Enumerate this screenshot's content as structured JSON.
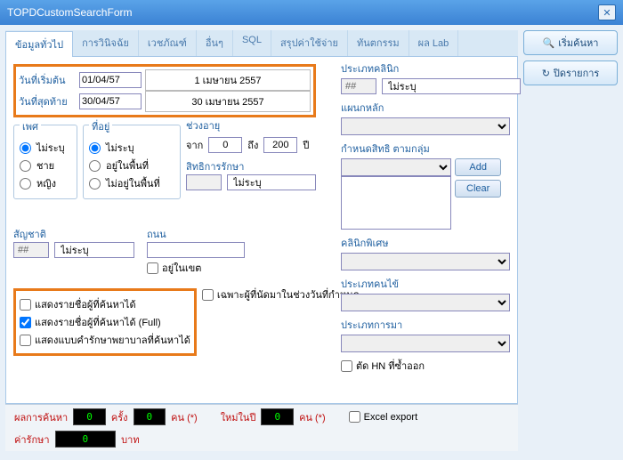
{
  "window": {
    "title": "TOPDCustomSearchForm"
  },
  "actions": {
    "search": "เริ่มค้นหา",
    "close": "ปิดรายการ"
  },
  "tabs": [
    "ข้อมูลทั่วไป",
    "การวินิจฉัย",
    "เวชภัณฑ์",
    "อื่นๆ",
    "SQL",
    "สรุปค่าใช้จ่าย",
    "ทันตกรรม",
    "ผล Lab"
  ],
  "dates": {
    "start_lbl": "วันที่เริ่มต้น",
    "start_val": "01/04/57",
    "start_txt": "1 เมษายน 2557",
    "end_lbl": "วันที่สุดท้าย",
    "end_val": "30/04/57",
    "end_txt": "30 เมษายน 2557"
  },
  "gender": {
    "title": "เพศ",
    "opts": [
      "ไม่ระบุ",
      "ชาย",
      "หญิง"
    ]
  },
  "location": {
    "title": "ที่อยู่",
    "opts": [
      "ไม่ระบุ",
      "อยู่ในพื้นที่",
      "ไม่อยู่ในพื้นที่"
    ]
  },
  "age": {
    "title": "ช่วงอายุ",
    "from_lbl": "จาก",
    "from": "0",
    "to_lbl": "ถึง",
    "to": "200",
    "unit": "ปี"
  },
  "insurance": {
    "lbl": "สิทธิการรักษา",
    "code": "",
    "txt": "ไม่ระบุ"
  },
  "clinic_type": {
    "lbl": "ประเภทคลินิก",
    "code": "##",
    "txt": "ไม่ระบุ"
  },
  "main_dept": {
    "lbl": "แผนกหลัก"
  },
  "rights_group": {
    "lbl": "กำหนดสิทธิ ตามกลุ่ม",
    "add": "Add",
    "clear": "Clear"
  },
  "special_clinic": {
    "lbl": "คลินิกพิเศษ"
  },
  "nationality": {
    "lbl": "สัญชาติ",
    "code": "##",
    "txt": "ไม่ระบุ"
  },
  "road": {
    "lbl": "ถนน",
    "in_area": "อยู่ในเขต"
  },
  "user_type": {
    "lbl": "ประเภทคนไข้"
  },
  "visit_type": {
    "lbl": "ประเภทการมา"
  },
  "checks": {
    "c1": "แสดงรายชื่อผู้ที่ค้นหาได้",
    "c2": "แสดงรายชื่อผู้ที่ค้นหาได้ (Full)",
    "c3": "แสดงแบบคำรักษาพยาบาลที่ค้นหาได้",
    "c4": "เฉพาะผู้ที่นัดมาในช่วงวันที่กำหนด",
    "c5": "ตัด HN ที่ซ้ำออก"
  },
  "footer": {
    "result_lbl": "ผลการค้นหา",
    "result_val": "0",
    "times": "ครั้ง",
    "ppl_val": "0",
    "ppl": "คน (*)",
    "new_lbl": "ใหม่ในปี",
    "new_val": "0",
    "new_ppl": "คน (*)",
    "excel": "Excel export",
    "cost_lbl": "ค่ารักษา",
    "cost_val": "0",
    "baht": "บาท"
  }
}
